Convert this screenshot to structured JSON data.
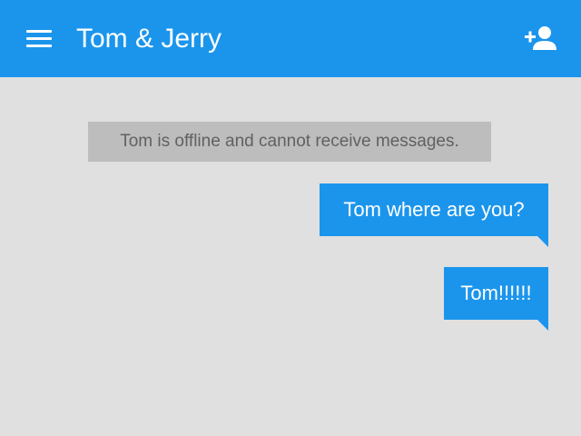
{
  "app_bar": {
    "title": "Tom & Jerry",
    "menu_icon": "hamburger-menu-icon",
    "add_user_icon": "add-person-icon",
    "background_color": "#1b95ec"
  },
  "chat": {
    "background_color": "#e0e0e0",
    "system_message": "Tom is offline and cannot receive messages.",
    "messages": [
      {
        "text": "Tom where are you?"
      },
      {
        "text": "Tom!!!!!!"
      }
    ],
    "bubble_color": "#1b95ec"
  }
}
